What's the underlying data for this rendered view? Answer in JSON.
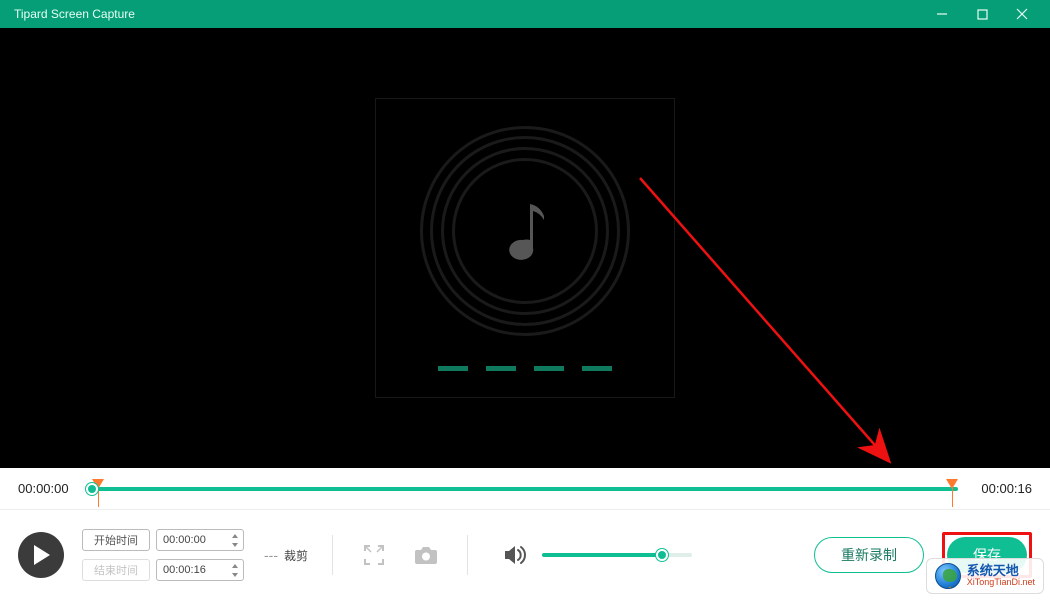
{
  "app": {
    "title": "Tipard Screen Capture"
  },
  "window_controls": {
    "minimize": "minimize",
    "maximize": "maximize",
    "close": "close"
  },
  "timeline": {
    "current": "00:00:00",
    "duration": "00:00:16"
  },
  "time_fields": {
    "start_label": "开始时间",
    "start_value": "00:00:00",
    "end_label": "结束时间",
    "end_value": "00:00:16",
    "crop_label": "裁剪"
  },
  "controls": {
    "fullscreen": "fullscreen",
    "snapshot": "snapshot",
    "volume_percent": 80
  },
  "buttons": {
    "rerecord": "重新录制",
    "save": "保存"
  },
  "watermark": {
    "cn": "系统天地",
    "en": "XiTongTianDi.net"
  },
  "colors": {
    "accent": "#0fbf93",
    "titlebar": "#059e77",
    "annotation": "#e11"
  }
}
